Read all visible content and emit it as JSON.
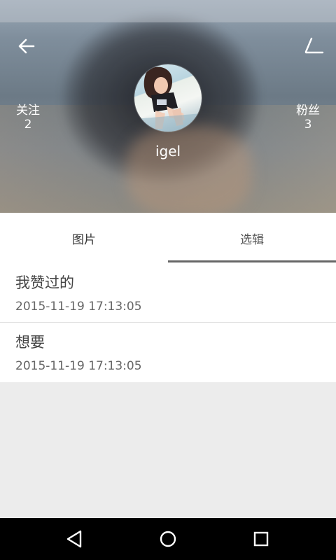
{
  "header": {
    "username": "igel",
    "following": {
      "label": "关注",
      "count": "2"
    },
    "followers": {
      "label": "粉丝",
      "count": "3"
    },
    "icons": {
      "back": "arrow-left-icon",
      "edit": "edit-icon"
    }
  },
  "tabs": [
    {
      "label": "图片",
      "selected": false
    },
    {
      "label": "选辑",
      "selected": true
    }
  ],
  "albums": [
    {
      "title": "我赞过的",
      "time": "2015-11-19 17:13:05"
    },
    {
      "title": "想要",
      "time": "2015-11-19 17:13:05"
    }
  ],
  "system_nav": {
    "icons": [
      "nav-back-icon",
      "nav-home-icon",
      "nav-recent-apps-icon"
    ]
  },
  "colors": {
    "tab_indicator": "#666666",
    "nav_bar": "#000000"
  }
}
